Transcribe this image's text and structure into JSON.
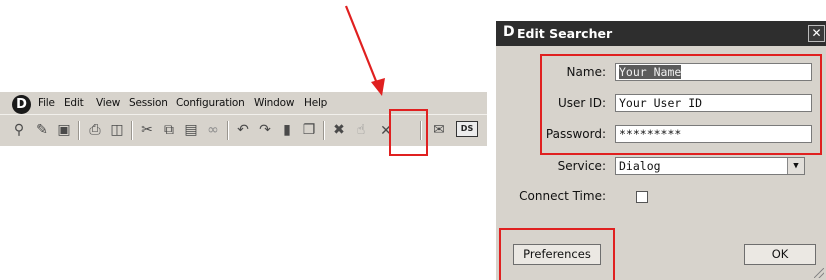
{
  "app": {
    "logo": "D",
    "menu": [
      "File",
      "Edit",
      "View",
      "Session",
      "Configuration",
      "Window",
      "Help"
    ],
    "toolbar_icons": [
      "search-icon",
      "edit-icon",
      "save-icon",
      "print-icon",
      "preview-icon",
      "cut-icon",
      "copy-icon",
      "paste-icon",
      "link-icon",
      "undo-icon",
      "redo-icon",
      "stop-icon",
      "window-icon",
      "cancel-icon",
      "hand-icon",
      "disconnect-icon",
      "mail-icon",
      "ds-icon"
    ],
    "ds_label": "DS"
  },
  "dialog": {
    "title": "Edit Searcher",
    "title_logo": "D",
    "close": "✕",
    "name_label": "Name:",
    "name_value": "Your Name",
    "userid_label": "User ID:",
    "userid_value": "Your User ID",
    "password_label": "Password:",
    "password_value": "*********",
    "service_label": "Service:",
    "service_value": "Dialog",
    "dropdown_arrow": "▼",
    "connect_time_label": "Connect Time:",
    "connect_time_checked": false,
    "preferences_button": "Preferences",
    "ok_button": "OK"
  },
  "annotation_color": "#e02020"
}
